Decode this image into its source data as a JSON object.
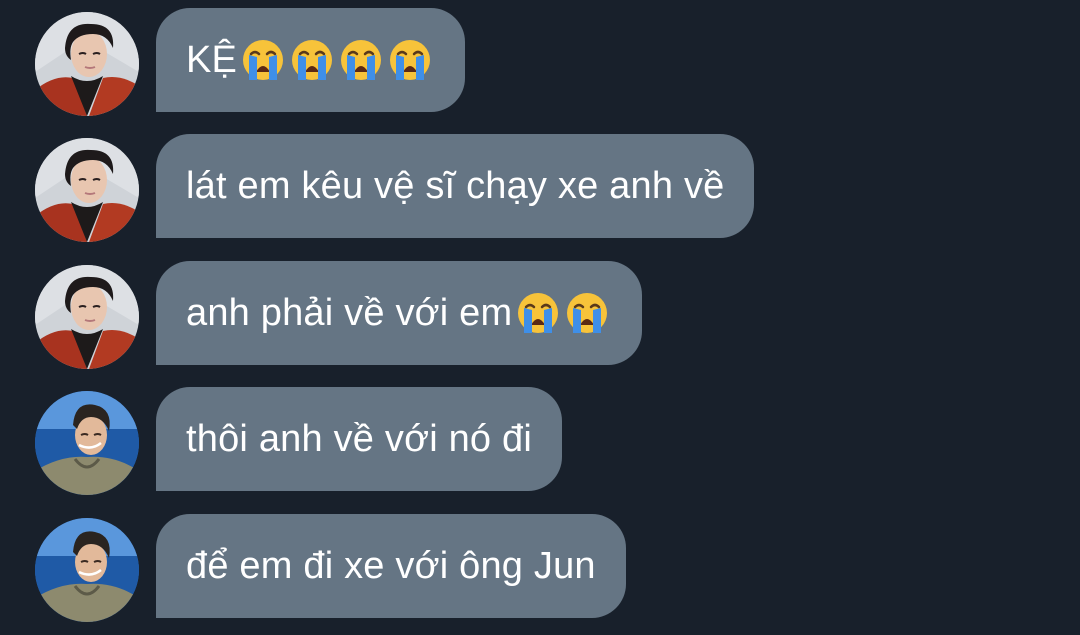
{
  "messages": [
    {
      "sender": "avatar-a",
      "text": "KỆ",
      "emojis": [
        "loudly-crying-face",
        "loudly-crying-face",
        "loudly-crying-face",
        "loudly-crying-face"
      ]
    },
    {
      "sender": "avatar-a",
      "text": "lát em kêu vệ sĩ chạy xe anh về",
      "emojis": []
    },
    {
      "sender": "avatar-a",
      "text": "anh phải về với em",
      "emojis": [
        "loudly-crying-face",
        "loudly-crying-face"
      ]
    },
    {
      "sender": "avatar-b",
      "text": "thôi anh về với nó đi",
      "emojis": []
    },
    {
      "sender": "avatar-b",
      "text": "để em đi xe với ông Jun",
      "emojis": []
    }
  ],
  "colors": {
    "background": "#18202b",
    "bubble": "#657584",
    "text": "#ffffff"
  }
}
